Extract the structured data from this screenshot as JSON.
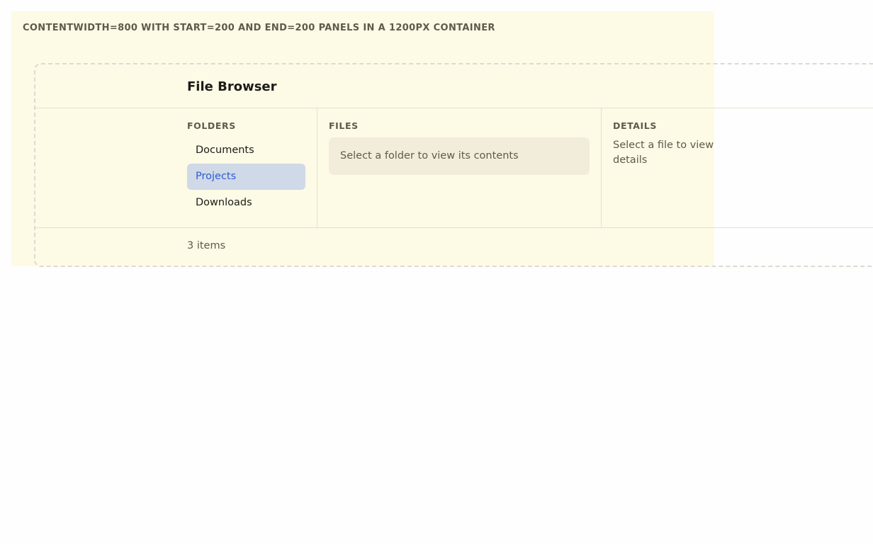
{
  "caption": "contentWidth=800 with start=200 and end=200 panels in a 1200px container",
  "header": {
    "title": "File Browser"
  },
  "folders": {
    "label": "Folders",
    "items": [
      {
        "label": "Documents",
        "selected": false
      },
      {
        "label": "Projects",
        "selected": true
      },
      {
        "label": "Downloads",
        "selected": false
      }
    ]
  },
  "files": {
    "label": "Files",
    "empty_message": "Select a folder to view its contents"
  },
  "details": {
    "label": "Details",
    "empty_message": "Select a file to view details"
  },
  "footer": {
    "status": "3 items"
  },
  "colors": {
    "background": "#fdfae6",
    "selected_bg": "#cfd9e8",
    "selected_text": "#2e5bd6",
    "divider": "#e4e1d3"
  }
}
